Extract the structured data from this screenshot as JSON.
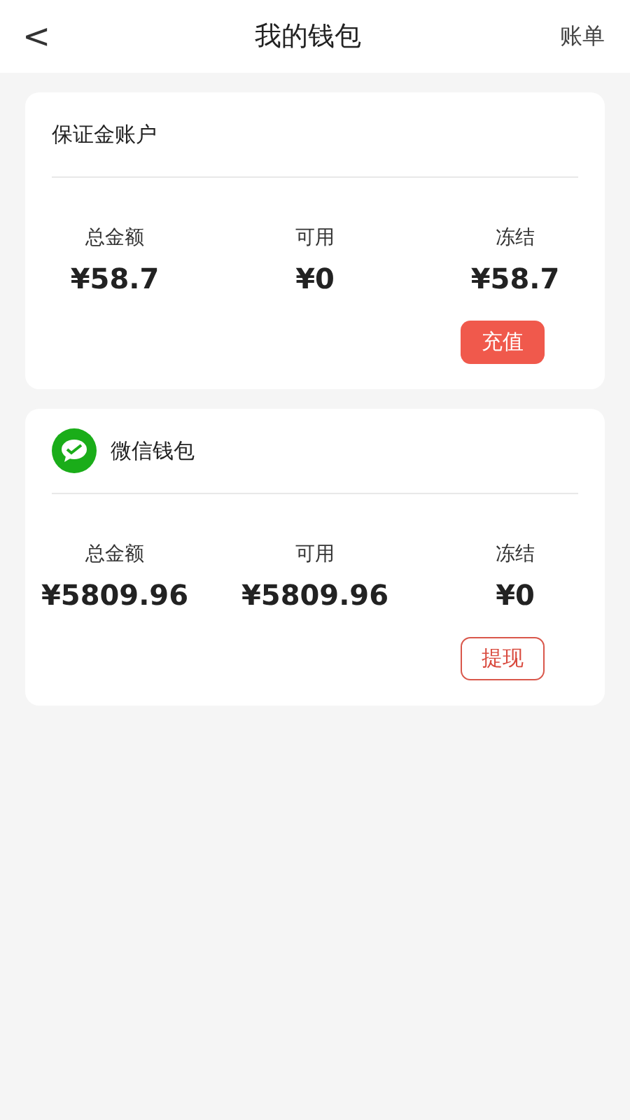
{
  "header": {
    "back": "<",
    "title": "我的钱包",
    "action": "账单"
  },
  "accounts": [
    {
      "kind": "plain",
      "title": "保证金账户",
      "stats": [
        {
          "label": "总金额",
          "value": "¥58.7"
        },
        {
          "label": "可用",
          "value": "¥0"
        },
        {
          "label": "冻结",
          "value": "¥58.7"
        }
      ],
      "button": {
        "kind": "filled",
        "label": "充值"
      }
    },
    {
      "kind": "logo",
      "title": "微信钱包",
      "stats": [
        {
          "label": "总金额",
          "value": "¥5809.96"
        },
        {
          "label": "可用",
          "value": "¥5809.96"
        },
        {
          "label": "冻结",
          "value": "¥0"
        }
      ],
      "button": {
        "kind": "outline",
        "label": "提现"
      }
    }
  ]
}
